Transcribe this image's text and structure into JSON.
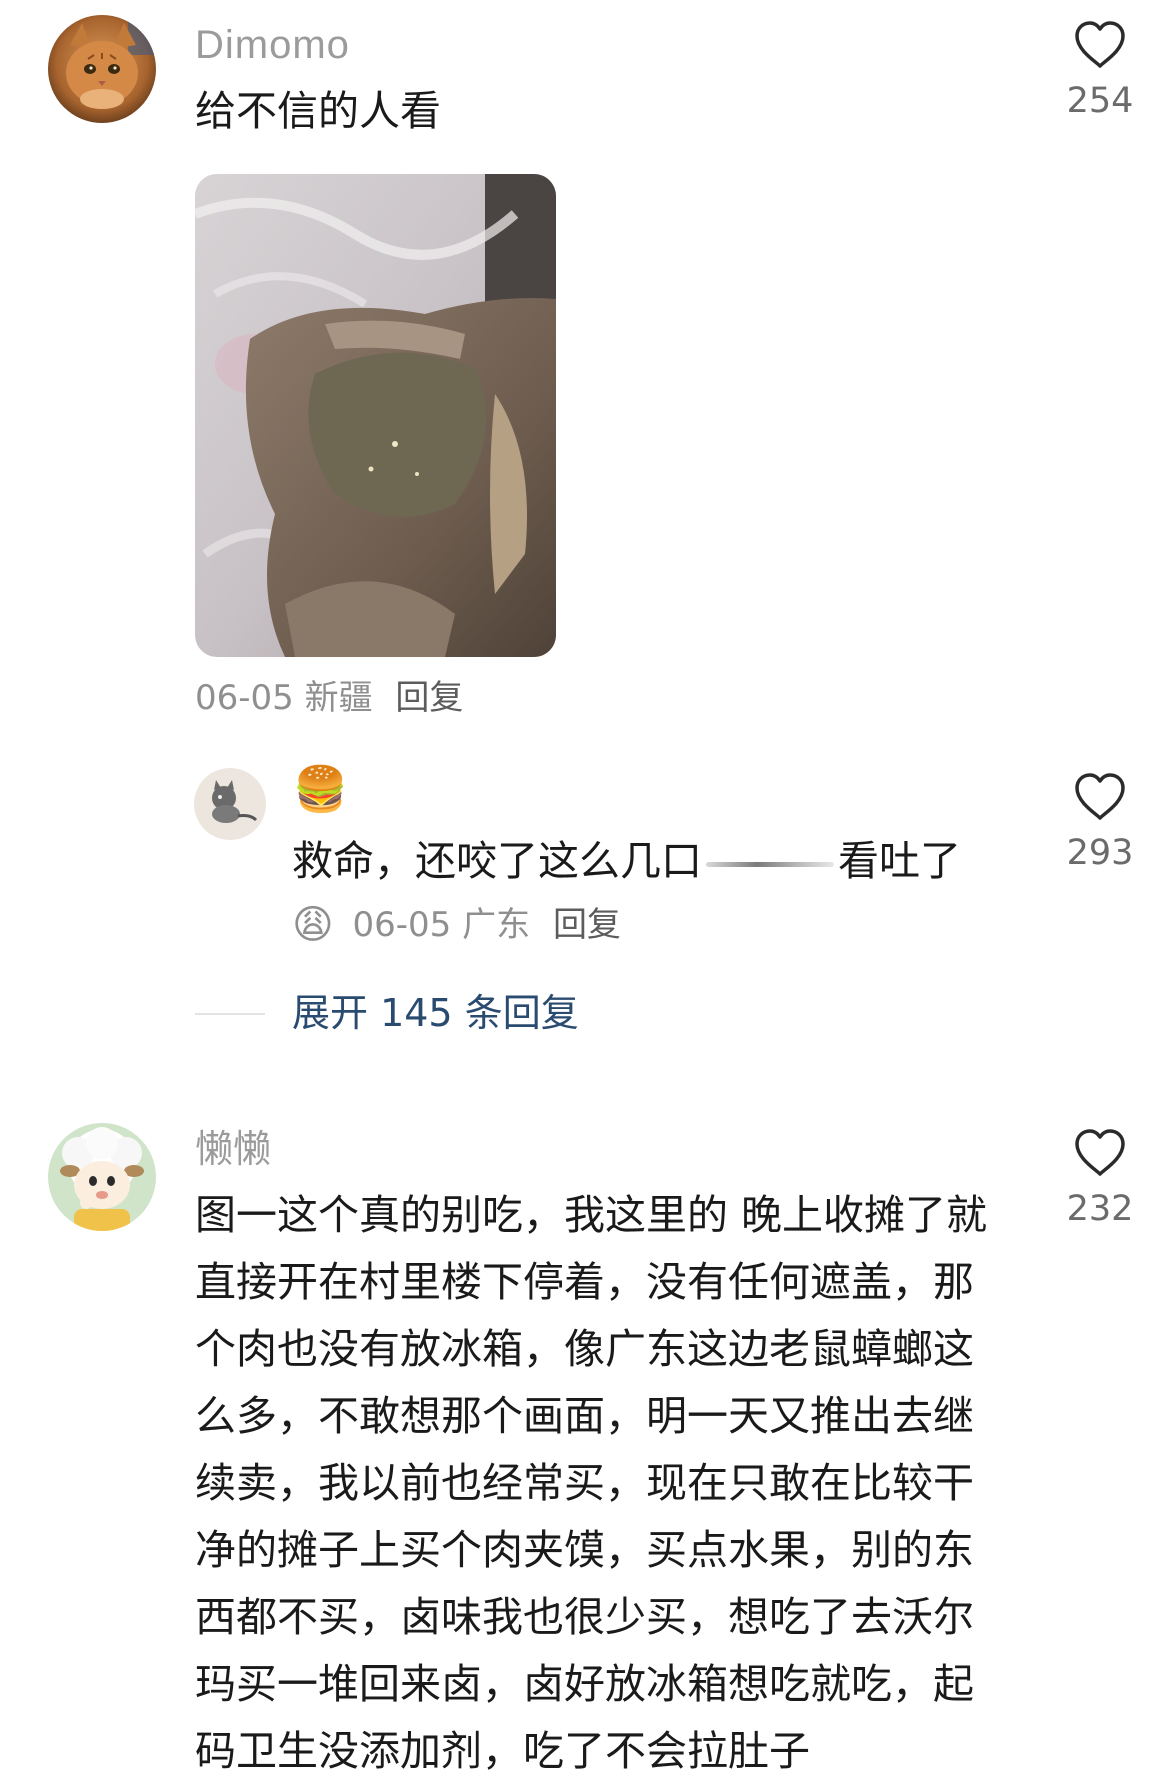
{
  "comments": [
    {
      "username": "Dimomo",
      "text": "给不信的人看",
      "likes": "254",
      "date": "06-05",
      "location": "新疆",
      "reply_label": "回复"
    },
    {
      "username": "懒懒",
      "lines": [
        "图一这个真的别吃，我这里的 晚上收摊了就",
        "直接开在村里楼下停着，没有任何遮盖，那",
        "个肉也没有放冰箱，像广东这边老鼠蟑螂这",
        "么多，不敢想那个画面，明一天又推出去继",
        "续卖，我以前也经常买，现在只敢在比较干",
        "净的摊子上买个肉夹馍，买点水果，别的东",
        "西都不买，卤味我也很少买，想吃了去沃尔",
        "玛买一堆回来卤，卤好放冰箱想吃就吃，起",
        "码卫生没添加剂，吃了不会拉肚子"
      ],
      "likes": "232"
    }
  ],
  "reply": {
    "username_emoji": "🍔",
    "text_before": "救命，还咬了这么几口",
    "text_after": "看吐了",
    "badge_emoji": "😩",
    "date": "06-05",
    "location": "广东",
    "reply_label": "回复",
    "likes": "293"
  },
  "expand_replies": "展开 145 条回复",
  "icons": {
    "like": "heart-outline-icon"
  },
  "colors": {
    "link": "#2a4b70",
    "muted": "#9b9b9b"
  }
}
